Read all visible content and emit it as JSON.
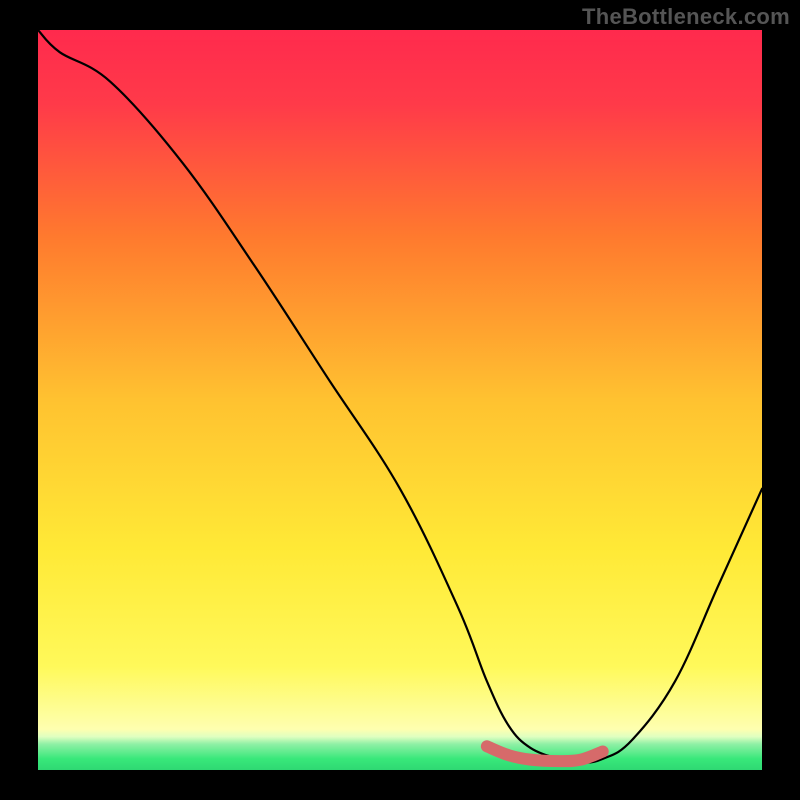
{
  "watermark": "TheBottleneck.com",
  "colors": {
    "page_bg": "#000000",
    "grad_top": "#ff2a4d",
    "grad_upper_mid": "#ff7a2e",
    "grad_mid": "#ffd233",
    "grad_lower_mid": "#fff95a",
    "grad_bottom_yellow": "#feffb0",
    "grad_green": "#38e87a",
    "curve": "#000000",
    "highlight": "#d66a6a",
    "watermark": "#555555"
  },
  "chart_data": {
    "type": "line",
    "title": "",
    "xlabel": "",
    "ylabel": "",
    "ylim": [
      0,
      100
    ],
    "xlim": [
      0,
      100
    ],
    "series": [
      {
        "name": "bottleneck-curve",
        "x": [
          0,
          3,
          10,
          20,
          30,
          40,
          50,
          58,
          62,
          65,
          68,
          72,
          75,
          78,
          82,
          88,
          94,
          100
        ],
        "values": [
          100,
          97,
          93,
          82,
          68,
          53,
          38,
          22,
          12,
          6,
          3,
          1.5,
          1,
          1.5,
          4,
          12,
          25,
          38
        ]
      },
      {
        "name": "optimal-region",
        "x": [
          62,
          65,
          68,
          72,
          75,
          78
        ],
        "values": [
          3.2,
          2.0,
          1.4,
          1.2,
          1.4,
          2.5
        ]
      }
    ]
  }
}
